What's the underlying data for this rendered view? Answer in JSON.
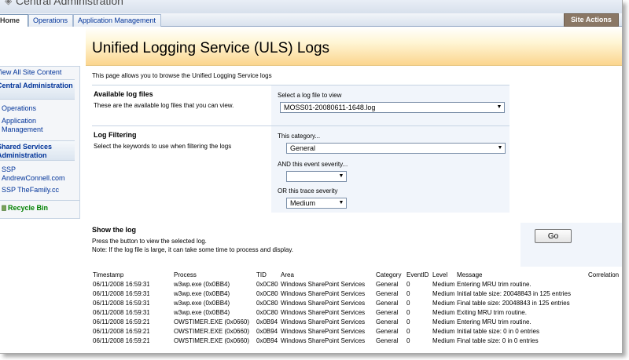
{
  "window": {
    "title": "Central Administration"
  },
  "topnav": {
    "tabs": [
      {
        "label": "Home"
      },
      {
        "label": "Operations"
      },
      {
        "label": "Application Management"
      }
    ],
    "site_actions": "Site Actions"
  },
  "page": {
    "title": "Unified Logging Service (ULS) Logs",
    "intro": "This page allows you to browse the Unified Logging Service logs"
  },
  "leftnav": {
    "view_all": "View All Site Content",
    "central_admin": "Central Administration",
    "operations": "Operations",
    "application_management": "Application Management",
    "shared_services": "Shared Services Administration",
    "ssp1": "SSP AndrewConnell.com",
    "ssp2": "SSP TheFamily.cc",
    "recycle_bin": "Recycle Bin"
  },
  "available": {
    "title": "Available log files",
    "desc": "These are the available log files that you can view.",
    "field_label": "Select a log file to view",
    "selected": "MOSS01-20080611-1648.log"
  },
  "filtering": {
    "title": "Log Filtering",
    "desc": "Select the keywords to use when filtering the logs",
    "category_label": "This category...",
    "category_value": "General",
    "severity_label": "AND this event severity...",
    "severity_value": "",
    "trace_label": "OR this trace severity",
    "trace_value": "Medium"
  },
  "show": {
    "title": "Show the log",
    "desc1": "Press the button to view the selected log.",
    "desc2": "Note: If the log file is large, it can take some time to process and display.",
    "go": "Go"
  },
  "log_table": {
    "headers": [
      "Timestamp",
      "Process",
      "TID",
      "Area",
      "Category",
      "EventID",
      "Level",
      "Message",
      "Correlation"
    ],
    "rows": [
      [
        "06/11/2008 16:59:31.19",
        "w3wp.exe (0x0BB4)",
        "0x0C80",
        "Windows SharePoint Services",
        "General",
        "0",
        "Medium",
        "Entering MRU trim routine.",
        ""
      ],
      [
        "06/11/2008 16:59:31.19",
        "w3wp.exe (0x0BB4)",
        "0x0C80",
        "Windows SharePoint Services",
        "General",
        "0",
        "Medium",
        "Initial table size: 20048843 in 125 entries",
        ""
      ],
      [
        "06/11/2008 16:59:31.19",
        "w3wp.exe (0x0BB4)",
        "0x0C80",
        "Windows SharePoint Services",
        "General",
        "0",
        "Medium",
        "Final table size: 20048843 in 125 entries",
        ""
      ],
      [
        "06/11/2008 16:59:31.19",
        "w3wp.exe (0x0BB4)",
        "0x0C80",
        "Windows SharePoint Services",
        "General",
        "0",
        "Medium",
        "Exiting MRU trim routine.",
        ""
      ],
      [
        "06/11/2008 16:59:21.69",
        "OWSTIMER.EXE (0x0660)",
        "0x0B94",
        "Windows SharePoint Services",
        "General",
        "0",
        "Medium",
        "Entering MRU trim routine.",
        ""
      ],
      [
        "06/11/2008 16:59:21.69",
        "OWSTIMER.EXE (0x0660)",
        "0x0B94",
        "Windows SharePoint Services",
        "General",
        "0",
        "Medium",
        "Initial table size: 0 in 0 entries",
        ""
      ],
      [
        "06/11/2008 16:59:21.69",
        "OWSTIMER.EXE (0x0660)",
        "0x0B94",
        "Windows SharePoint Services",
        "General",
        "0",
        "Medium",
        "Final table size: 0 in 0 entries",
        ""
      ]
    ]
  },
  "colors": {
    "accent": "#003399",
    "title_band": "#fbd58e",
    "recycle": "#008000"
  }
}
